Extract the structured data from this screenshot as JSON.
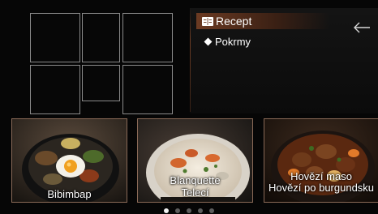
{
  "menu": {
    "items": [
      {
        "label": "Recept",
        "icon": "book-icon",
        "selected": true
      },
      {
        "label": "Pokrmy",
        "icon": "diamond-icon",
        "selected": false
      }
    ],
    "back_icon": "back-arrow-icon",
    "accent": "#6b3a22"
  },
  "cards": [
    {
      "label_lines": [
        "Bibimbap"
      ]
    },
    {
      "label_lines": [
        "Blanquette",
        "Telecí"
      ]
    },
    {
      "label_lines": [
        "Hovězí maso",
        "Hovězí po burgundsku"
      ]
    }
  ],
  "pagination": {
    "count": 5,
    "active_index": 0
  }
}
